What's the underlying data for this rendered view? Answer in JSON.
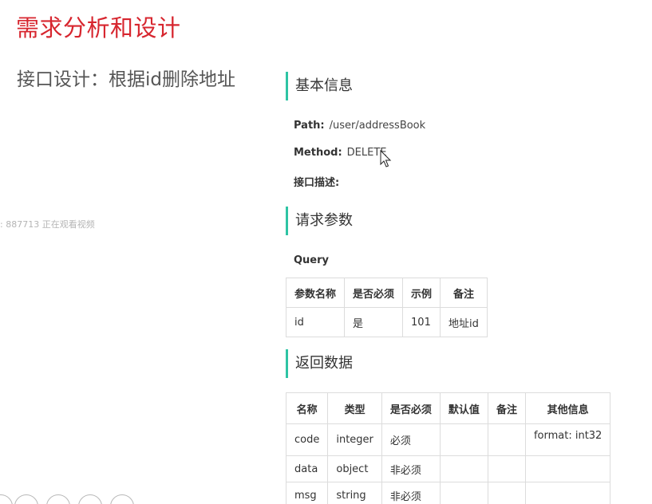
{
  "title": "需求分析和设计",
  "subtitle": "接口设计：根据id删除地址",
  "watermark": "887713 正在观看视频",
  "sections": {
    "basic_info": "基本信息",
    "request_params": "请求参数",
    "response_data": "返回数据"
  },
  "basic": {
    "path_label": "Path:",
    "path_value": "/user/addressBook",
    "method_label": "Method:",
    "method_value": "DELETE",
    "desc_label": "接口描述:"
  },
  "query_label": "Query",
  "params_table": {
    "headers": [
      "参数名称",
      "是否必须",
      "示例",
      "备注"
    ],
    "rows": [
      [
        "id",
        "是",
        "101",
        "地址id"
      ]
    ]
  },
  "response_table": {
    "headers": [
      "名称",
      "类型",
      "是否必须",
      "默认值",
      "备注",
      "其他信息"
    ],
    "rows": [
      [
        "code",
        "integer",
        "必须",
        "",
        "",
        "format: int32"
      ],
      [
        "data",
        "object",
        "非必须",
        "",
        "",
        ""
      ],
      [
        "msg",
        "string",
        "非必须",
        "",
        "",
        ""
      ]
    ]
  },
  "icons": {
    "cursor": "mouse-pointer-icon",
    "bottom_toolbar": [
      "back-icon",
      "pen-icon",
      "grid-icon",
      "zoom-icon",
      "more-icon"
    ]
  },
  "colors": {
    "title": "#d7262f",
    "section_accent": "#2ec4a4"
  }
}
